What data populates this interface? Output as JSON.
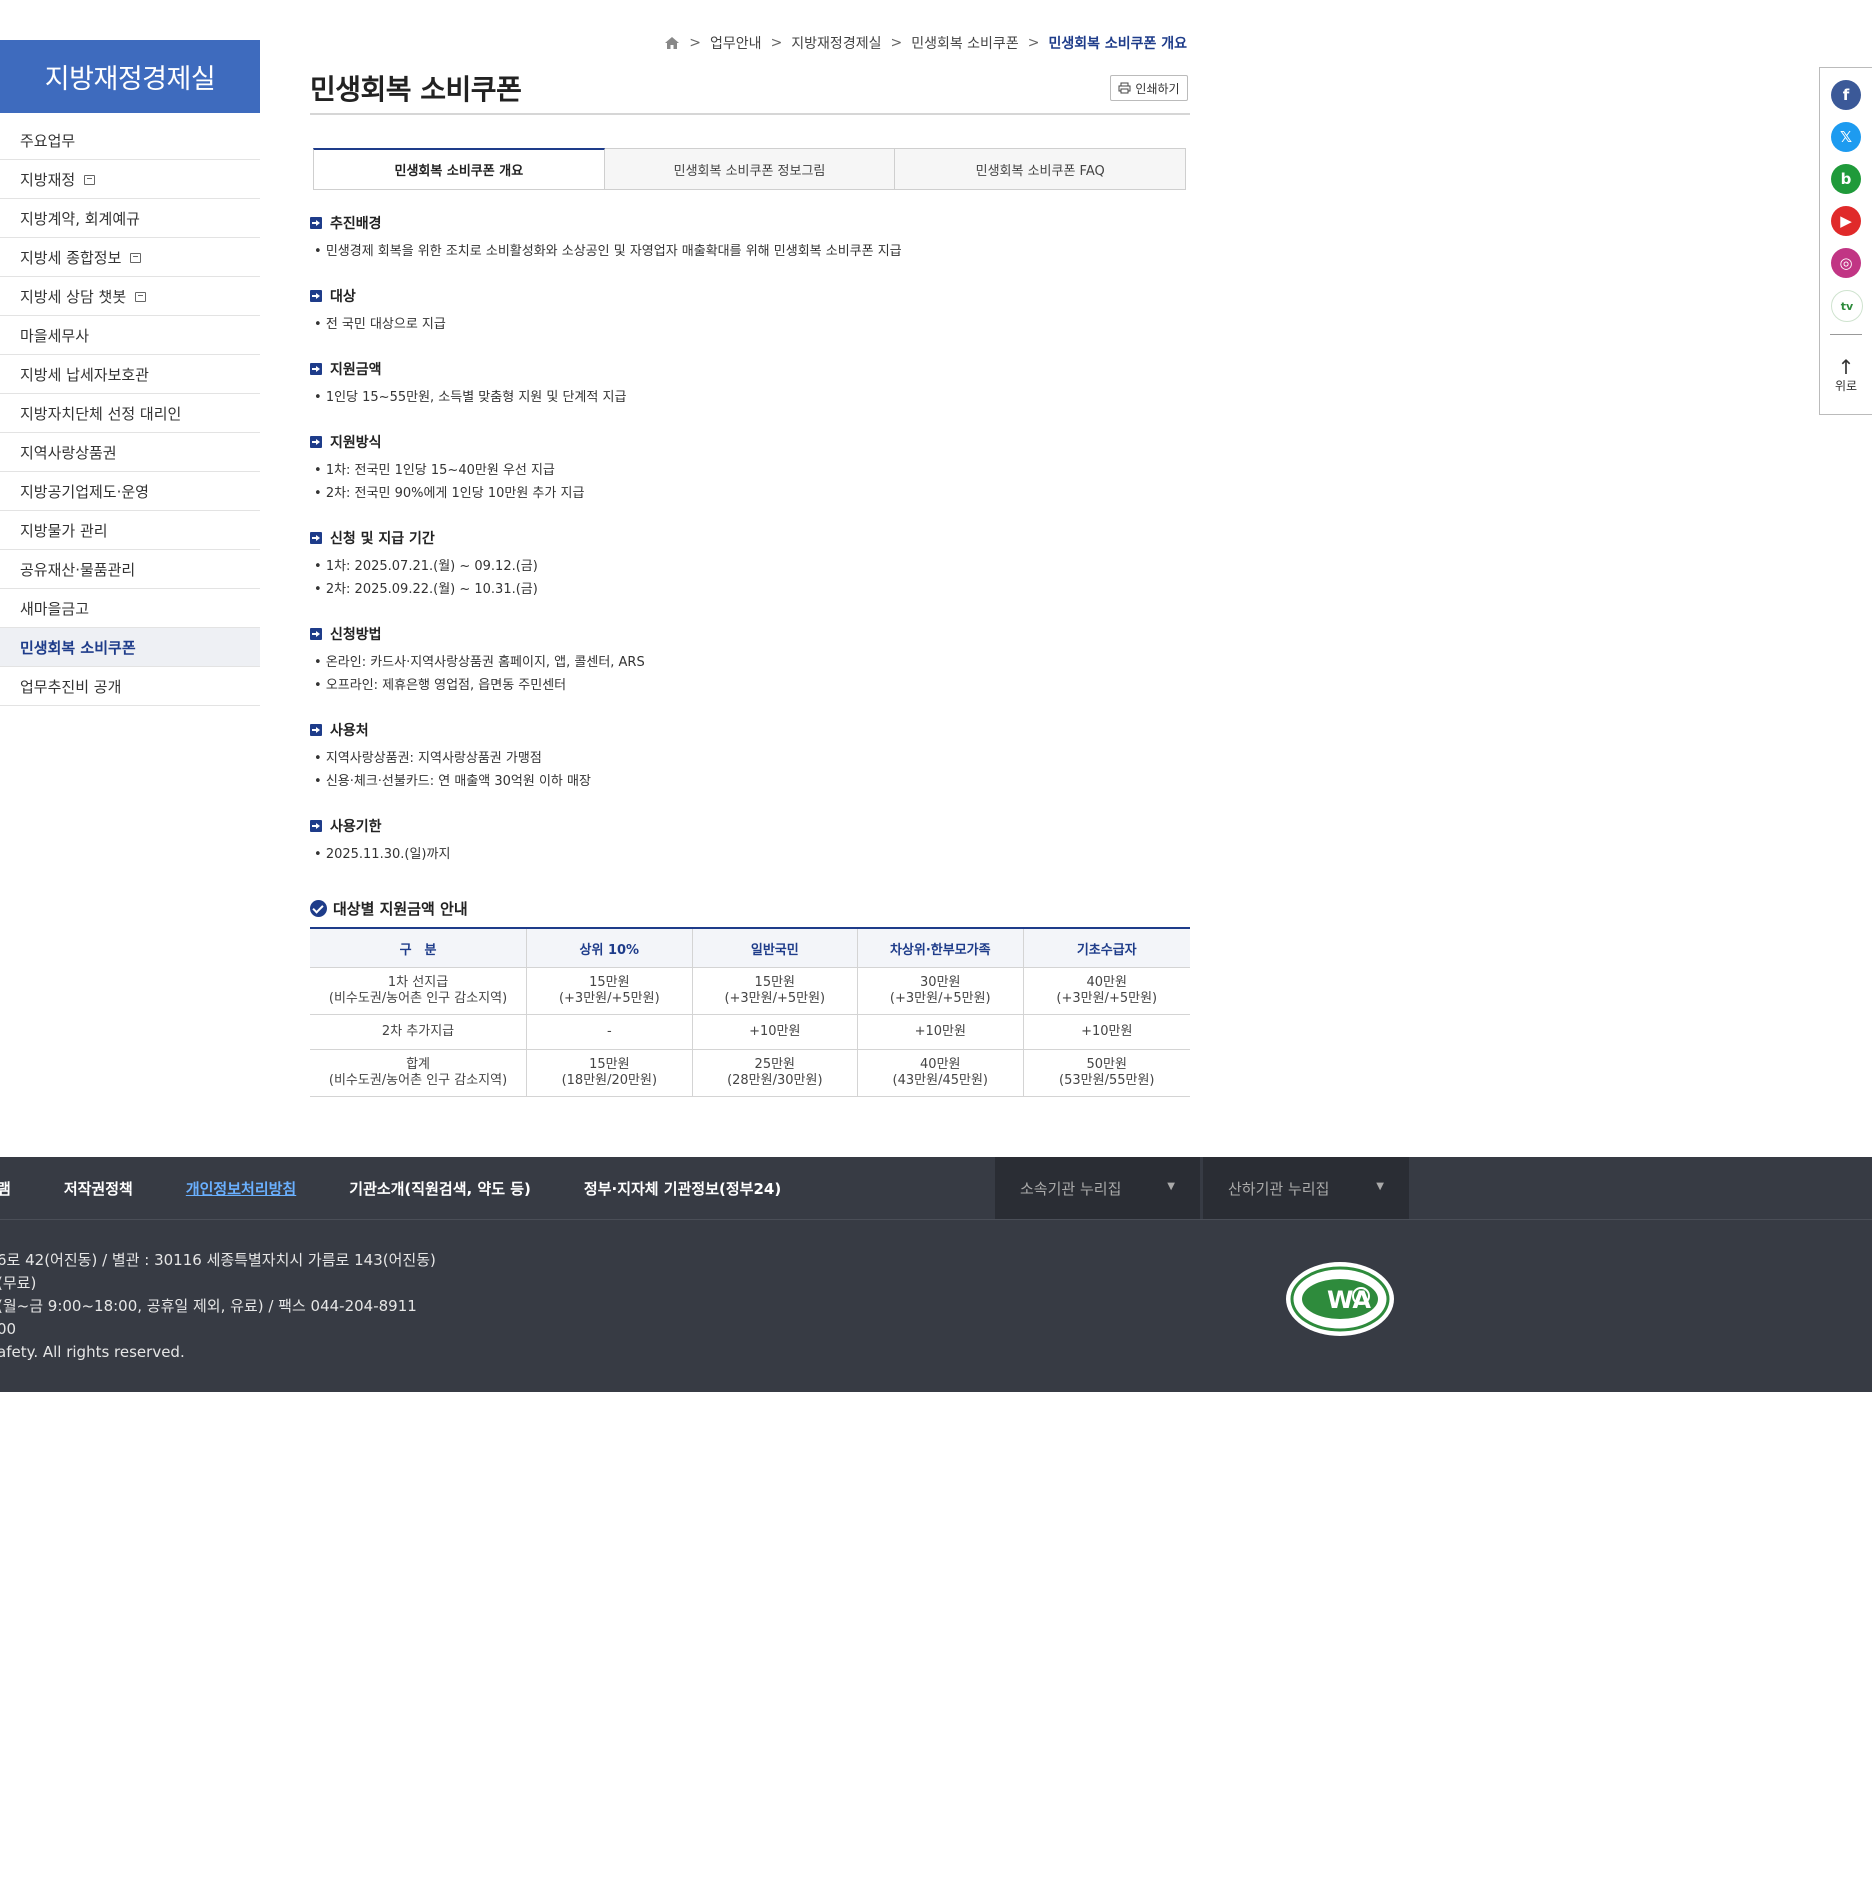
{
  "sidebar": {
    "title": "지방재정경제실",
    "items": [
      {
        "label": "주요업무",
        "ext": false,
        "active": false
      },
      {
        "label": "지방재정",
        "ext": true,
        "active": false
      },
      {
        "label": "지방계약, 회계예규",
        "ext": false,
        "active": false
      },
      {
        "label": "지방세 종합정보",
        "ext": true,
        "active": false
      },
      {
        "label": "지방세 상담 챗봇",
        "ext": true,
        "active": false
      },
      {
        "label": "마을세무사",
        "ext": false,
        "active": false
      },
      {
        "label": "지방세 납세자보호관",
        "ext": false,
        "active": false
      },
      {
        "label": "지방자치단체 선정 대리인",
        "ext": false,
        "active": false
      },
      {
        "label": "지역사랑상품권",
        "ext": false,
        "active": false
      },
      {
        "label": "지방공기업제도·운영",
        "ext": false,
        "active": false
      },
      {
        "label": "지방물가 관리",
        "ext": false,
        "active": false
      },
      {
        "label": "공유재산·물품관리",
        "ext": false,
        "active": false
      },
      {
        "label": "새마을금고",
        "ext": false,
        "active": false
      },
      {
        "label": "민생회복 소비쿠폰",
        "ext": false,
        "active": true
      },
      {
        "label": "업무추진비 공개",
        "ext": false,
        "active": false
      }
    ]
  },
  "breadcrumb": {
    "items": [
      "업무안내",
      "지방재정경제실",
      "민생회복 소비쿠폰"
    ],
    "current": "민생회복 소비쿠폰 개요",
    "separator": ">"
  },
  "page": {
    "title": "민생회복 소비쿠폰",
    "print_label": "인쇄하기"
  },
  "tabs": [
    {
      "label": "민생회복 소비쿠폰 개요",
      "active": true
    },
    {
      "label": "민생회복 소비쿠폰 정보그림",
      "active": false
    },
    {
      "label": "민생회복 소비쿠폰 FAQ",
      "active": false
    }
  ],
  "sections": [
    {
      "title": "추진배경",
      "bullets": [
        "민생경제 회복을 위한 조치로 소비활성화와 소상공인 및 자영업자 매출확대를 위해 민생회복 소비쿠폰 지급"
      ]
    },
    {
      "title": "대상",
      "bullets": [
        "전 국민 대상으로 지급"
      ]
    },
    {
      "title": "지원금액",
      "bullets": [
        "1인당 15~55만원, 소득별 맞춤형 지원 및 단계적 지급"
      ]
    },
    {
      "title": "지원방식",
      "bullets": [
        "1차: 전국민 1인당 15~40만원 우선 지급",
        "2차: 전국민 90%에게 1인당 10만원 추가 지급"
      ]
    },
    {
      "title": "신청 및 지급 기간",
      "bullets": [
        "1차: 2025.07.21.(월) ~ 09.12.(금)",
        "2차: 2025.09.22.(월) ~ 10.31.(금)"
      ]
    },
    {
      "title": "신청방법",
      "bullets": [
        "온라인: 카드사·지역사랑상품권 홈페이지, 앱, 콜센터, ARS",
        "오프라인: 제휴은행 영업점, 읍면동 주민센터"
      ]
    },
    {
      "title": "사용처",
      "bullets": [
        "지역사랑상품권: 지역사랑상품권 가맹점",
        "신용·체크·선불카드: 연 매출액 30억원 이하 매장"
      ]
    },
    {
      "title": "사용기한",
      "bullets": [
        "2025.11.30.(일)까지"
      ]
    }
  ],
  "support_table": {
    "title": "대상별 지원금액 안내",
    "headers": [
      "구　분",
      "상위 10%",
      "일반국민",
      "차상위·한부모가족",
      "기초수급자"
    ],
    "rows": [
      [
        "1차 선지급\n(비수도권/농어촌 인구 감소지역)",
        "15만원\n(+3만원/+5만원)",
        "15만원\n(+3만원/+5만원)",
        "30만원\n(+3만원/+5만원)",
        "40만원\n(+3만원/+5만원)"
      ],
      [
        "2차 추가지급",
        "-",
        "+10만원",
        "+10만원",
        "+10만원"
      ],
      [
        "합계\n(비수도권/농어촌 인구 감소지역)",
        "15만원\n(18만원/20만원)",
        "25만원\n(28만원/30만원)",
        "40만원\n(43만원/45만원)",
        "50만원\n(53만원/55만원)"
      ]
    ]
  },
  "social": {
    "items": [
      {
        "name": "facebook",
        "glyph": "f",
        "color": "#3b5998"
      },
      {
        "name": "x",
        "glyph": "𝕏",
        "color": "#1d9bf0"
      },
      {
        "name": "blog",
        "glyph": "b",
        "color": "#1f9a3a"
      },
      {
        "name": "youtube",
        "glyph": "▶",
        "color": "#e02a2a"
      },
      {
        "name": "instagram",
        "glyph": "◎",
        "color": "#c13584"
      },
      {
        "name": "tv",
        "glyph": "tv",
        "color": "#ffffff"
      }
    ],
    "top_label": "위로"
  },
  "footer": {
    "links": [
      {
        "label": "램",
        "privacy": false
      },
      {
        "label": "저작권정책",
        "privacy": false
      },
      {
        "label": "개인정보처리방침",
        "privacy": true
      },
      {
        "label": "기관소개(직원검색, 약도 등)",
        "privacy": false
      },
      {
        "label": "정부·지자체 기관정보(정부24)",
        "privacy": false
      }
    ],
    "selects": [
      "소속기관 누리집",
      "산하기관 누리집"
    ],
    "info_lines": [
      "6로 42(어진동) / 별관 : 30116 세종특별자치시 가름로 143(어진동)",
      "(무료)",
      "(월~금 9:00~18:00, 공휴일 제외, 유료) / 팩스 044-204-8911",
      "00",
      "afety. All rights reserved."
    ],
    "wa_text": "WA"
  },
  "colors": {
    "brand": "#3e6bbe",
    "accent": "#1e3c8a",
    "footer": "#373b44"
  }
}
